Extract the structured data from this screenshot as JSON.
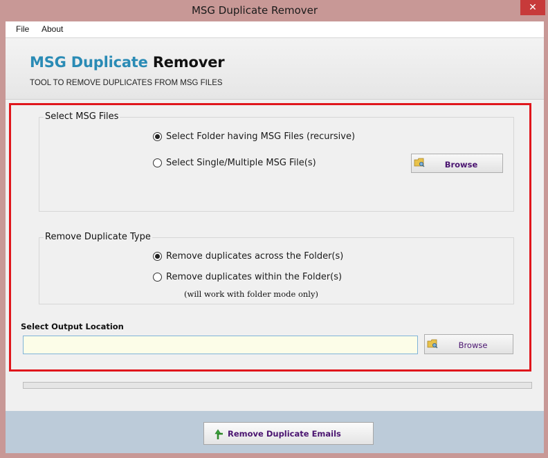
{
  "window": {
    "title": "MSG Duplicate Remover",
    "close_glyph": "✕"
  },
  "menu": {
    "items": [
      "File",
      "About"
    ]
  },
  "header": {
    "title_part1": "MSG Duplicate",
    "title_part2": "Remover",
    "subtitle": "TOOL TO REMOVE DUPLICATES FROM MSG FILES"
  },
  "select_files": {
    "label": "Select MSG Files",
    "option_folder": "Select Folder having MSG Files (recursive)",
    "option_files": "Select Single/Multiple MSG File(s)",
    "selected": "folder",
    "browse_label": "Browse"
  },
  "duplicate_type": {
    "label": "Remove Duplicate Type",
    "option_across": "Remove duplicates across the Folder(s)",
    "option_within": "Remove duplicates within the Folder(s)",
    "selected": "across",
    "note": "(will work with folder mode only)"
  },
  "output": {
    "label": "Select  Output Location",
    "value": "",
    "browse_label": "Browse"
  },
  "progress": {
    "value": 0
  },
  "action": {
    "label": "Remove Duplicate Emails"
  },
  "colors": {
    "accent": "#2a8bb5",
    "frame_red": "#e0161c",
    "button_text_purple": "#4a1470",
    "footer_bg": "#bccbd9",
    "window_border": "#c89896"
  },
  "icons": [
    "close-icon",
    "folder-browse-icon",
    "upload-arrow-icon"
  ]
}
